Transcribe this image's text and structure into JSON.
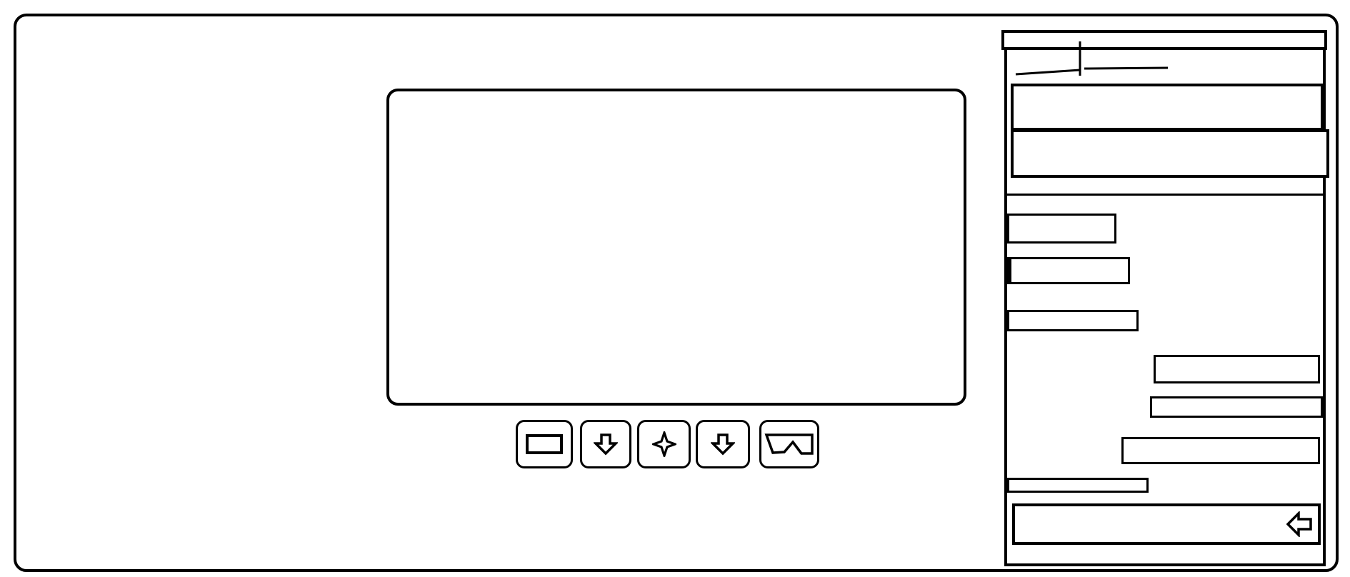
{
  "app": {
    "title": ""
  },
  "video": {
    "participant_label": ""
  },
  "controls": {
    "buttons": [
      {
        "id": "stop",
        "icon": "rectangle-icon"
      },
      {
        "id": "mic",
        "icon": "down-arrow-icon"
      },
      {
        "id": "effects",
        "icon": "sparkle-icon"
      },
      {
        "id": "camera",
        "icon": "down-arrow-icon"
      },
      {
        "id": "share",
        "icon": "share-screen-icon"
      }
    ]
  },
  "side_panel": {
    "header_title": "",
    "fields": [
      {
        "value": "",
        "placeholder": ""
      },
      {
        "value": "",
        "placeholder": ""
      }
    ],
    "messages": [
      {
        "side": "left",
        "text": ""
      },
      {
        "side": "left",
        "text": ""
      },
      {
        "side": "left",
        "text": ""
      },
      {
        "side": "right",
        "text": ""
      },
      {
        "side": "right",
        "text": ""
      },
      {
        "side": "right",
        "text": ""
      },
      {
        "side": "left",
        "text": ""
      }
    ],
    "chat_input": {
      "value": "",
      "placeholder": ""
    },
    "send_icon": "left-arrow-icon"
  },
  "colors": {
    "ink": "#000000",
    "background": "#ffffff"
  }
}
